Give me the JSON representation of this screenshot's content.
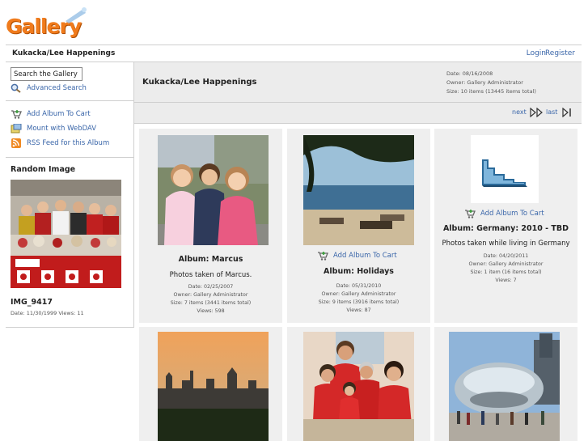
{
  "header": {
    "logo_text": "Gallery"
  },
  "topbar": {
    "breadcrumb": "Kukacka/Lee Happenings",
    "login": "Login",
    "register": "Register"
  },
  "sidebar": {
    "search_value": "Search the Gallery",
    "advanced_search": "Advanced Search",
    "actions": [
      {
        "label": "Add Album To Cart",
        "icon": "cart-icon"
      },
      {
        "label": "Mount with WebDAV",
        "icon": "webdav-icon"
      },
      {
        "label": "RSS Feed for this Album",
        "icon": "rss-icon"
      }
    ],
    "random_title": "Random Image",
    "random_name": "IMG_9417",
    "random_meta": "Date: 11/30/1999 Views: 11"
  },
  "album": {
    "title": "Kukacka/Lee Happenings",
    "date": "Date: 08/16/2008",
    "owner": "Owner: Gallery Administrator",
    "size": "Size: 10 items (13445 items total)"
  },
  "pager": {
    "next": "next",
    "last": "last"
  },
  "items": [
    {
      "title": "Album: Marcus",
      "desc": "Photos taken of Marcus.",
      "date": "Date: 02/25/2007",
      "owner": "Owner: Gallery Administrator",
      "size": "Size: 7 items (3441 items total)",
      "views": "Views: 598"
    },
    {
      "cart": "Add Album To Cart",
      "title": "Album: Holidays",
      "date": "Date: 05/31/2010",
      "owner": "Owner: Gallery Administrator",
      "size": "Size: 9 items (3916 items total)",
      "views": "Views: 87"
    },
    {
      "cart": "Add Album To Cart",
      "title": "Album: Germany: 2010 - TBD",
      "desc": "Photos taken while living in Germany",
      "date": "Date: 04/20/2011",
      "owner": "Owner: Gallery Administrator",
      "size": "Size: 1 item (16 items total)",
      "views": "Views: 7"
    }
  ],
  "colors": {
    "link": "#3a66a9",
    "logo": "#f07b1c",
    "panel": "#ececec"
  }
}
